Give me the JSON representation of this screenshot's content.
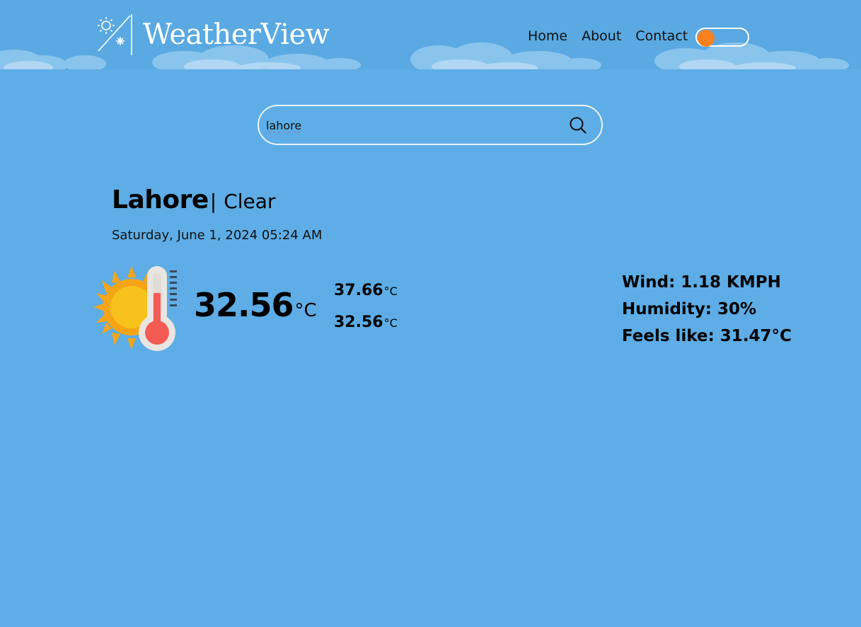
{
  "header": {
    "brand": "WeatherView",
    "nav": [
      {
        "label": "Home"
      },
      {
        "label": "About"
      },
      {
        "label": "Contact"
      }
    ],
    "theme_toggle": {
      "state": "off",
      "knob_color": "#f7811e"
    }
  },
  "search": {
    "value": "lahore",
    "placeholder": "",
    "icon": "search-icon"
  },
  "weather": {
    "city": "Lahore",
    "separator": "|",
    "condition": "Clear",
    "datetime": "Saturday, June 1, 2024 05:24 AM",
    "icon": "sun-thermometer-icon",
    "temp": "32.56",
    "temp_unit": "°C",
    "temp_max": "37.66",
    "temp_min": "32.56",
    "minmax_unit": "°C",
    "wind": "Wind: 1.18 KMPH",
    "humidity": "Humidity: 30%",
    "feels_like": "Feels like: 31.47°C"
  },
  "colors": {
    "background": "#5eade6",
    "accent": "#f7811e"
  }
}
